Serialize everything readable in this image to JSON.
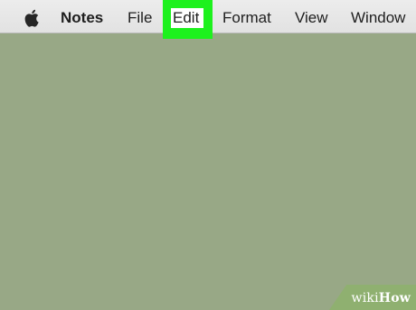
{
  "menubar": {
    "apple_icon": "apple-logo",
    "app_name": "Notes",
    "items": [
      "File",
      "Edit",
      "Format",
      "View",
      "Window"
    ],
    "highlighted_item": "Edit",
    "highlight_color": "#1df11d"
  },
  "desktop": {
    "background_color": "#98a886"
  },
  "watermark": {
    "prefix": "wiki",
    "suffix": "How"
  }
}
